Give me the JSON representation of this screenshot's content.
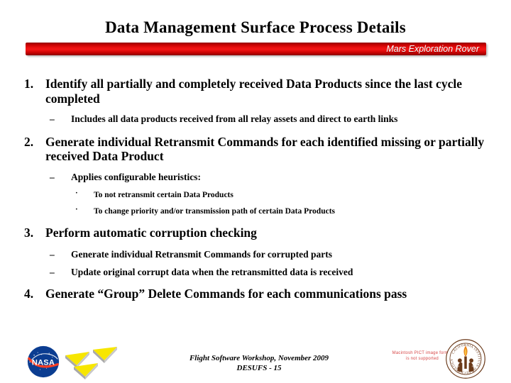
{
  "slide": {
    "title": "Data Management Surface Process Details",
    "banner": {
      "label": "Mars Exploration Rover",
      "color": "#ee1111"
    },
    "content": [
      {
        "level": 1,
        "marker": "1.",
        "text": "Identify all partially and completely received Data Products since the last cycle completed"
      },
      {
        "level": 2,
        "marker": "–",
        "text": "Includes all data products received from all relay assets and direct to earth links"
      },
      {
        "level": 1,
        "marker": "2.",
        "text": "Generate individual Retransmit Commands for each identified missing or partially received Data Product"
      },
      {
        "level": 2,
        "marker": "–",
        "text": "Applies configurable heuristics:"
      },
      {
        "level": 3,
        "marker": "·",
        "text": "To not retransmit certain Data Products"
      },
      {
        "level": 3,
        "marker": "·",
        "text": "To change priority and/or transmission path of certain Data Products"
      },
      {
        "level": 1,
        "marker": "3.",
        "text": "Perform automatic corruption checking"
      },
      {
        "level": 2,
        "marker": "–",
        "text": "Generate individual Retransmit Commands for corrupted parts"
      },
      {
        "level": 2,
        "marker": "–",
        "text": "Update original corrupt data when the retransmitted data is received"
      },
      {
        "level": 1,
        "marker": "4.",
        "text": "Generate “Group” Delete Commands for each communications pass"
      }
    ],
    "footer": {
      "line1": "Flight Software Workshop, November 2009",
      "line2": "DESUFS - 15",
      "nasa_logo_label": "NASA",
      "jpl_logo_label": "JPL chevrons",
      "pict_placeholder": "Macintosh PICT image format is not supported",
      "caltech_seal_label": "California Institute of Technology"
    }
  }
}
